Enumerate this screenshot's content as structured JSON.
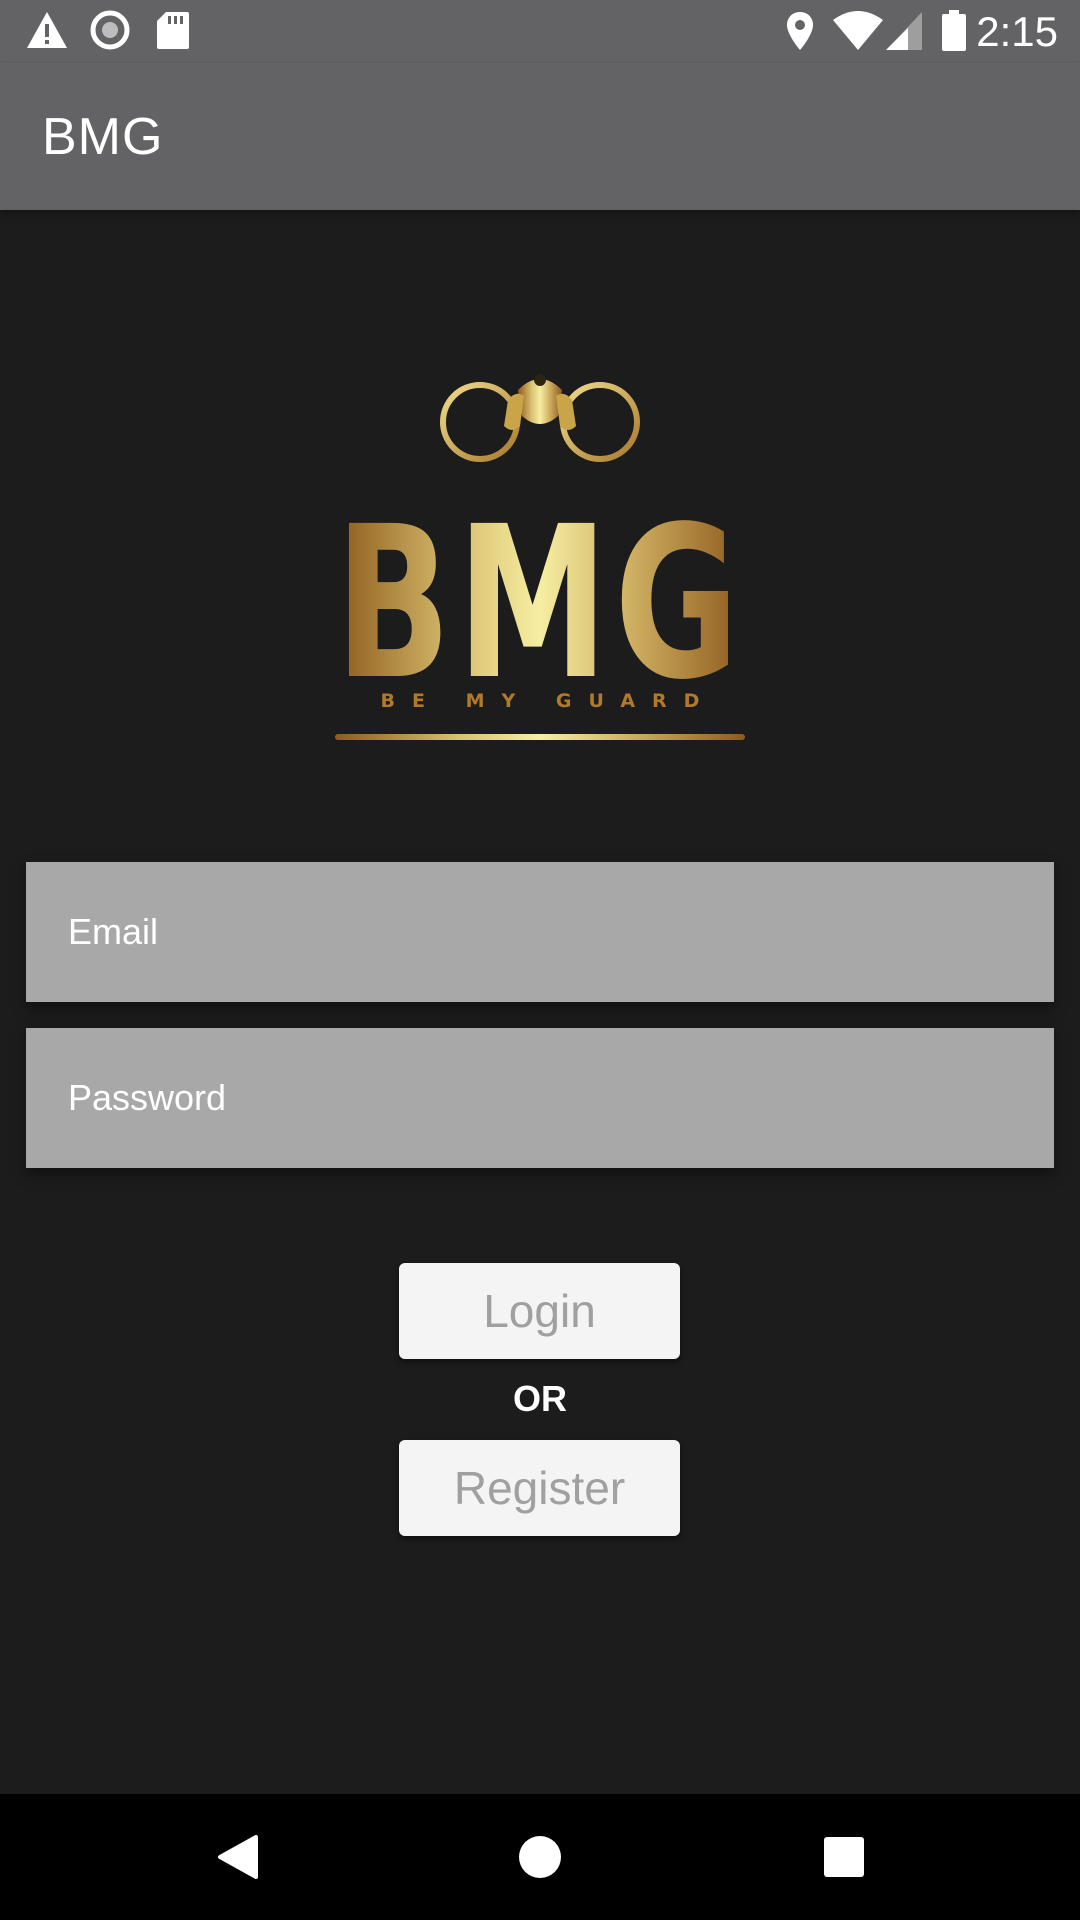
{
  "status_bar": {
    "time": "2:15",
    "left_icons": [
      "warning-icon",
      "sync-icon",
      "sd-card-icon"
    ],
    "right_icons": [
      "location-icon",
      "wifi-icon",
      "signal-icon",
      "battery-icon"
    ]
  },
  "app_bar": {
    "title": "BMG"
  },
  "logo": {
    "wordmark": "BMG",
    "tagline": "BE MY GUARD"
  },
  "form": {
    "email_placeholder": "Email",
    "password_placeholder": "Password",
    "login_label": "Login",
    "or_label": "OR",
    "register_label": "Register"
  },
  "nav_bar": {
    "icons": [
      "back-icon",
      "home-icon",
      "recents-icon"
    ]
  },
  "colors": {
    "status_bar_bg": "#636365",
    "screen_bg": "#1c1c1c",
    "input_bg": "#a8a8a8",
    "button_bg": "#f4f4f4",
    "button_text": "#a0a0a0",
    "gold": "#c9a448"
  }
}
